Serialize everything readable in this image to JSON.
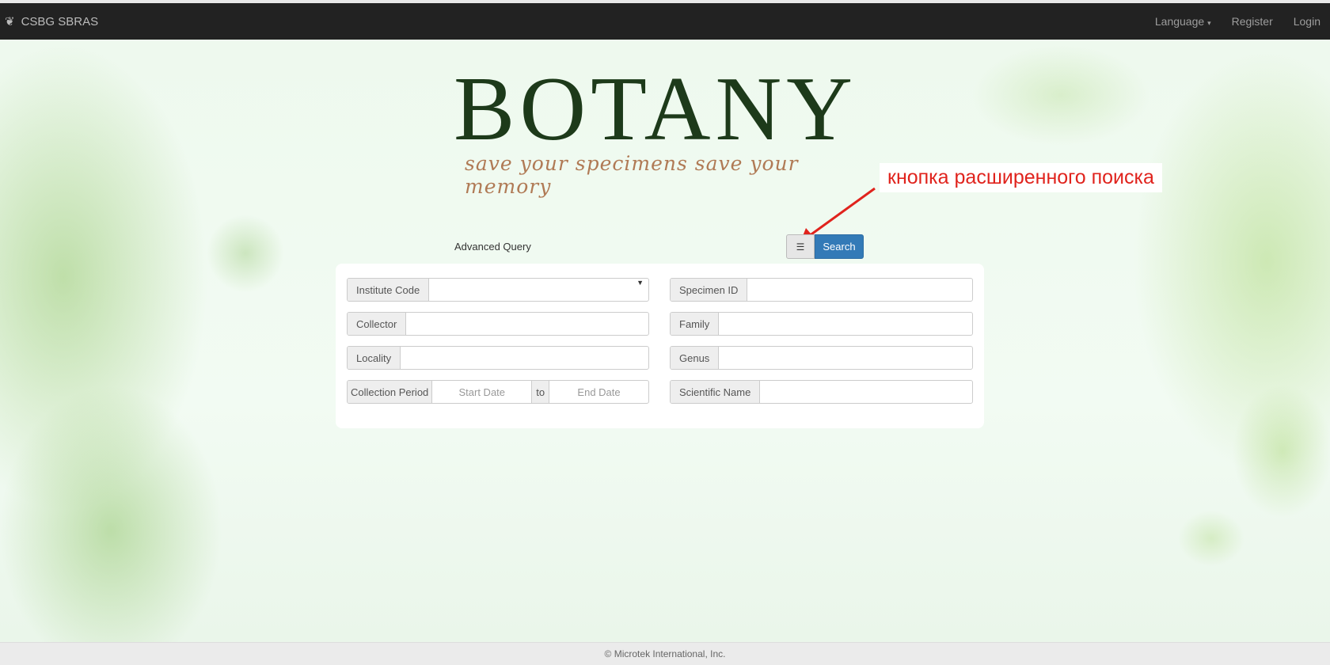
{
  "navbar": {
    "brand": "CSBG SBRAS",
    "language": "Language",
    "register": "Register",
    "login": "Login"
  },
  "logo": {
    "title": "BOTANY",
    "tagline": "save your specimens save your memory"
  },
  "annotation": "кнопка расширенного поиска",
  "query": {
    "label": "Advanced Query",
    "search_button": "Search",
    "toggle_icon": "list-icon"
  },
  "form": {
    "institute_code": "Institute Code",
    "collector": "Collector",
    "locality": "Locality",
    "collection_period": "Collection Period",
    "start_date_placeholder": "Start Date",
    "to": "to",
    "end_date_placeholder": "End Date",
    "specimen_id": "Specimen ID",
    "family": "Family",
    "genus": "Genus",
    "scientific_name": "Scientific Name"
  },
  "footer": "© Microtek International, Inc.",
  "colors": {
    "navbar": "#222222",
    "primary": "#337ab7",
    "annotation": "#e0231d"
  }
}
